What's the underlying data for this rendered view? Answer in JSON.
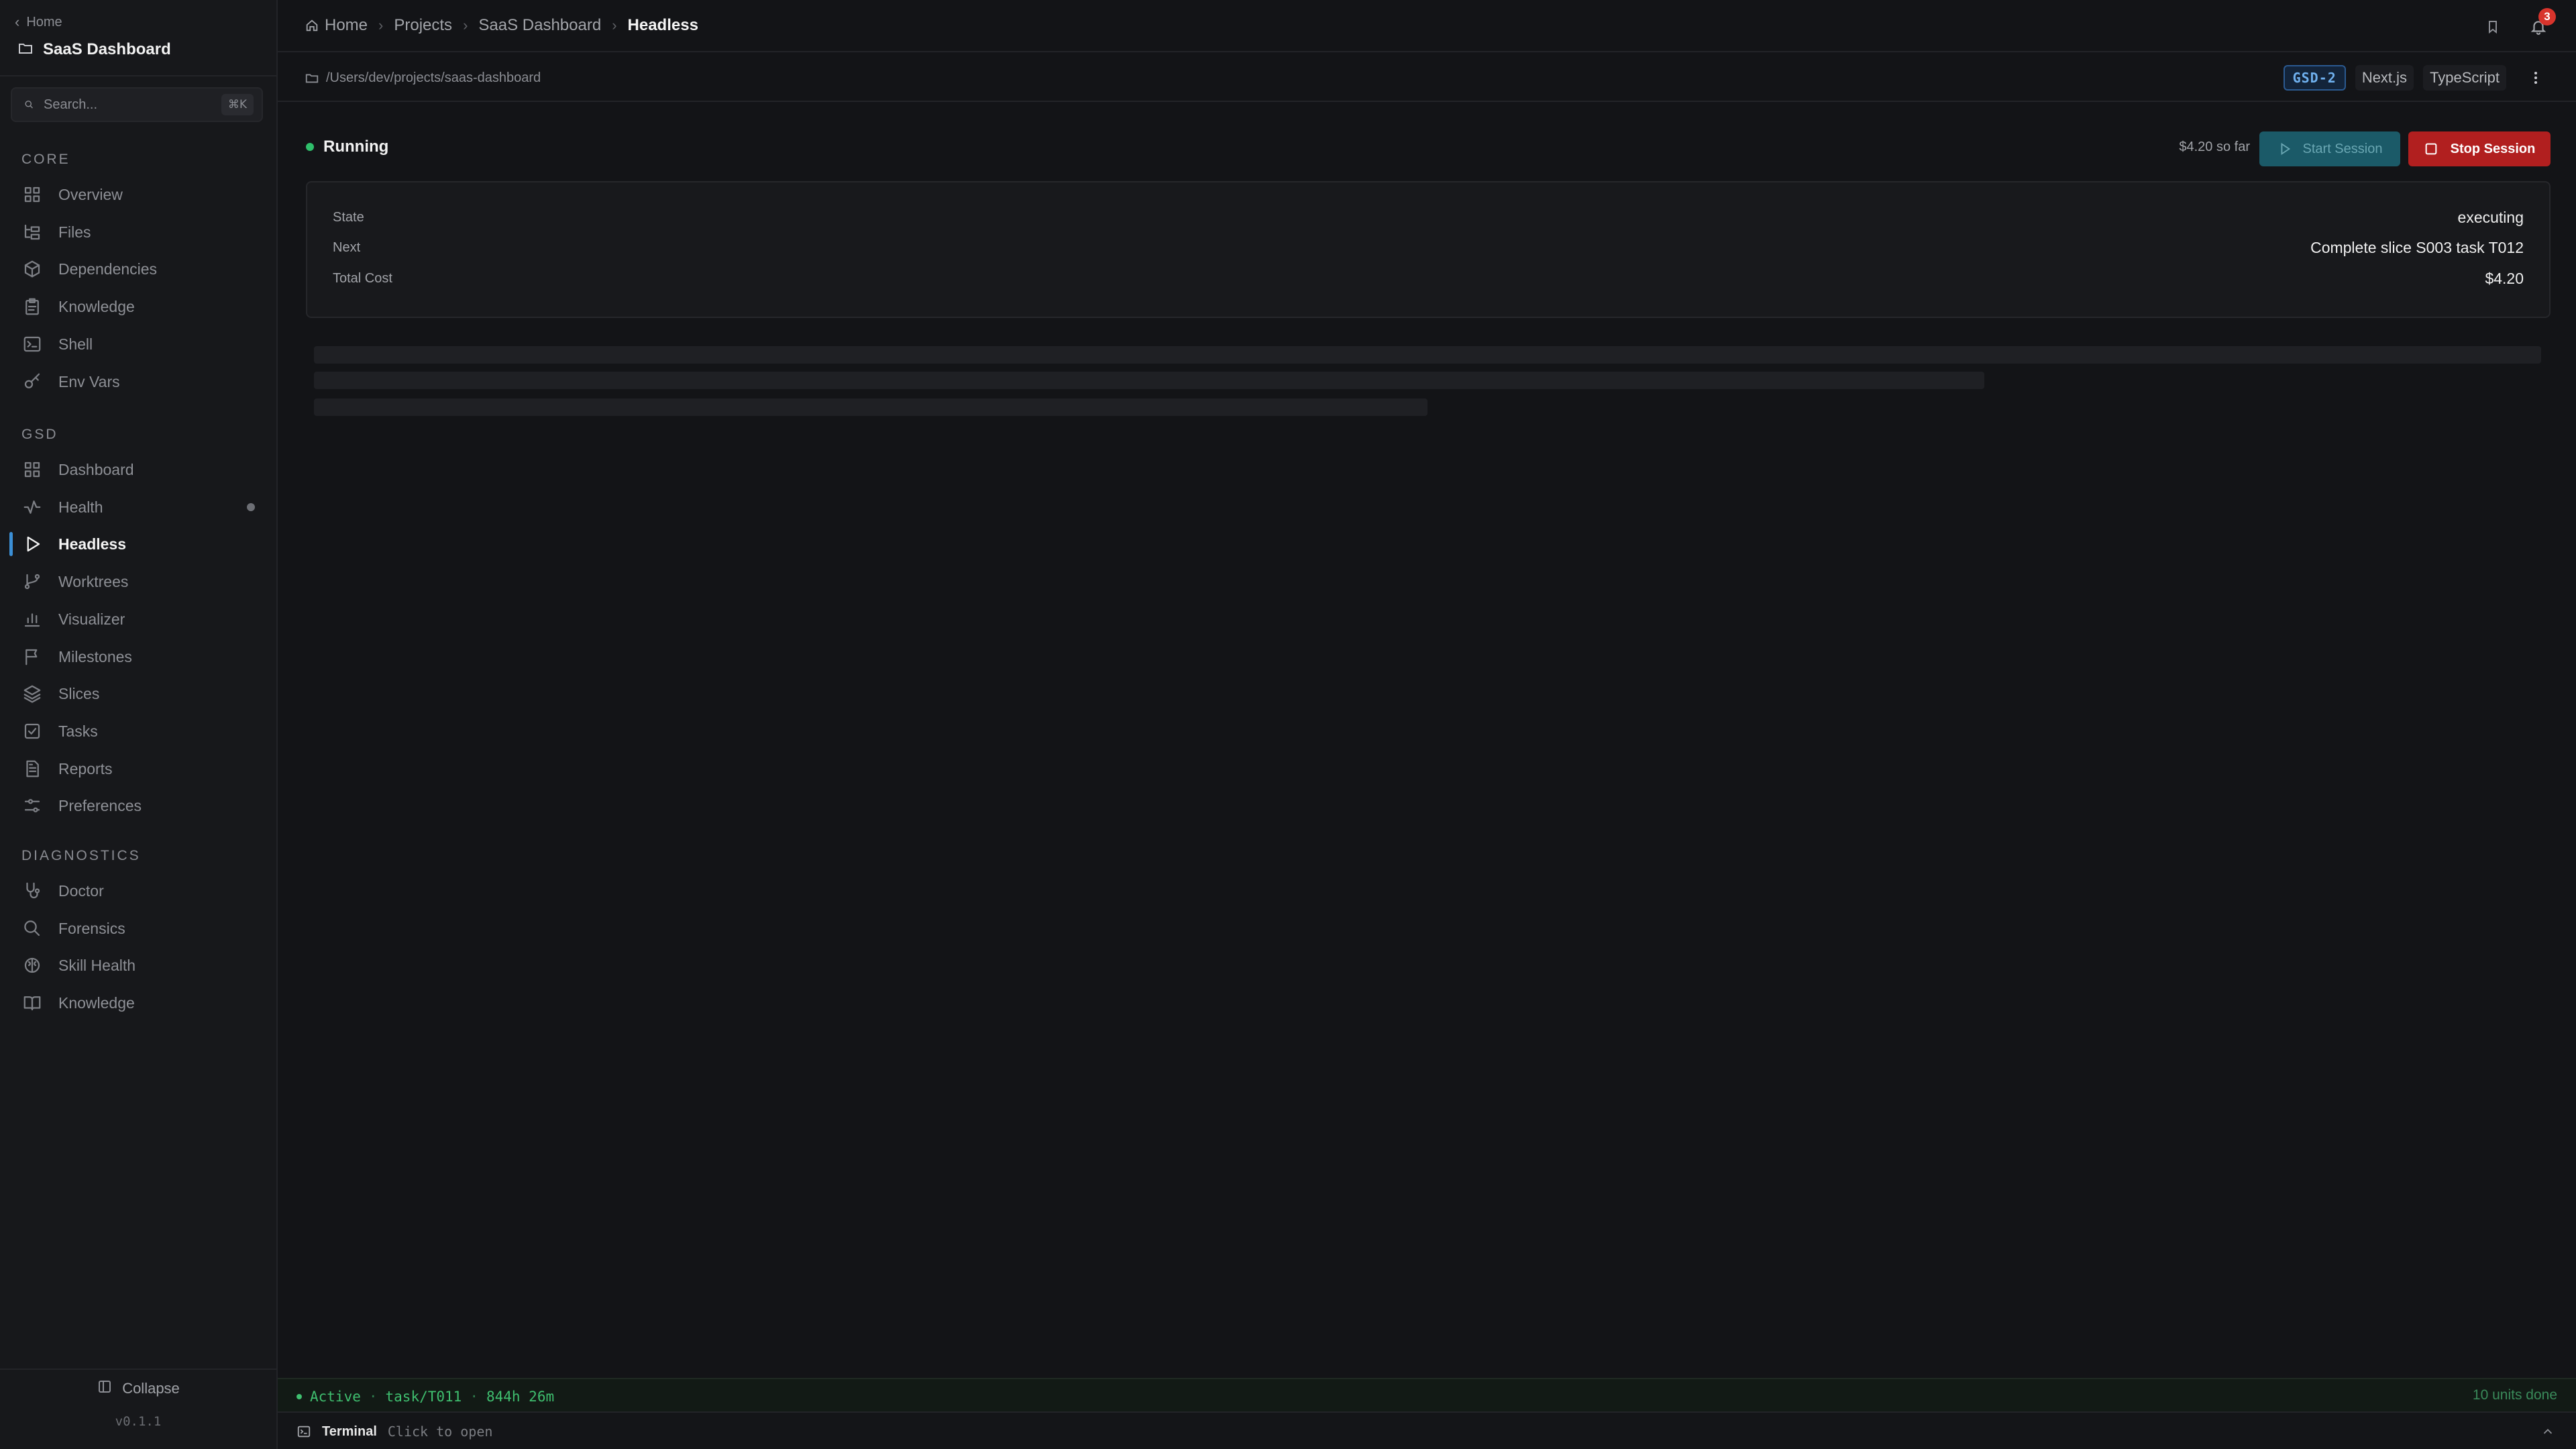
{
  "sidebar": {
    "back_label": "Home",
    "project_name": "SaaS Dashboard",
    "search": {
      "placeholder": "Search...",
      "shortcut": "⌘K"
    },
    "sections": [
      {
        "title": "CORE",
        "items": [
          {
            "label": "Overview",
            "icon": "layout-grid-icon"
          },
          {
            "label": "Files",
            "icon": "folder-tree-icon"
          },
          {
            "label": "Dependencies",
            "icon": "package-icon"
          },
          {
            "label": "Knowledge",
            "icon": "clipboard-icon"
          },
          {
            "label": "Shell",
            "icon": "terminal-icon"
          },
          {
            "label": "Env Vars",
            "icon": "key-icon"
          }
        ]
      },
      {
        "title": "GSD",
        "items": [
          {
            "label": "Dashboard",
            "icon": "layout-grid-icon"
          },
          {
            "label": "Health",
            "icon": "activity-icon",
            "dot": true
          },
          {
            "label": "Headless",
            "icon": "play-icon",
            "active": true
          },
          {
            "label": "Worktrees",
            "icon": "git-branch-icon"
          },
          {
            "label": "Visualizer",
            "icon": "bar-chart-icon"
          },
          {
            "label": "Milestones",
            "icon": "flag-icon"
          },
          {
            "label": "Slices",
            "icon": "layers-icon"
          },
          {
            "label": "Tasks",
            "icon": "check-square-icon"
          },
          {
            "label": "Reports",
            "icon": "report-icon"
          },
          {
            "label": "Preferences",
            "icon": "sliders-icon"
          }
        ]
      },
      {
        "title": "DIAGNOSTICS",
        "items": [
          {
            "label": "Doctor",
            "icon": "stethoscope-icon"
          },
          {
            "label": "Forensics",
            "icon": "search-icon"
          },
          {
            "label": "Skill Health",
            "icon": "brain-icon"
          },
          {
            "label": "Knowledge",
            "icon": "book-open-icon"
          }
        ]
      }
    ],
    "collapse_label": "Collapse",
    "version": "v0.1.1"
  },
  "topbar": {
    "breadcrumb": [
      "Home",
      "Projects",
      "SaaS Dashboard",
      "Headless"
    ],
    "notification_count": "3"
  },
  "pathbar": {
    "path": "/Users/dev/projects/saas-dashboard",
    "tags": {
      "gsd": "GSD-2",
      "framework": "Next.js",
      "language": "TypeScript"
    }
  },
  "session": {
    "status": "Running",
    "cost_so_far": "$4.20 so far",
    "start_label": "Start Session",
    "stop_label": "Stop Session",
    "details": [
      {
        "key": "State",
        "value": "executing"
      },
      {
        "key": "Next",
        "value": "Complete slice S003 task T012"
      },
      {
        "key": "Total Cost",
        "value": "$4.20"
      }
    ]
  },
  "statusbar": {
    "status": "Active",
    "task": "task/T011",
    "duration": "844h 26m",
    "summary": "10 units done"
  },
  "terminal": {
    "title": "Terminal",
    "hint": "Click to open"
  },
  "colors": {
    "background": "#131417",
    "sidebar": "#17181b",
    "accent": "#3b8fd6",
    "running": "#2fbf6b",
    "stop": "#b11f1f",
    "start": "#1b5a68"
  }
}
